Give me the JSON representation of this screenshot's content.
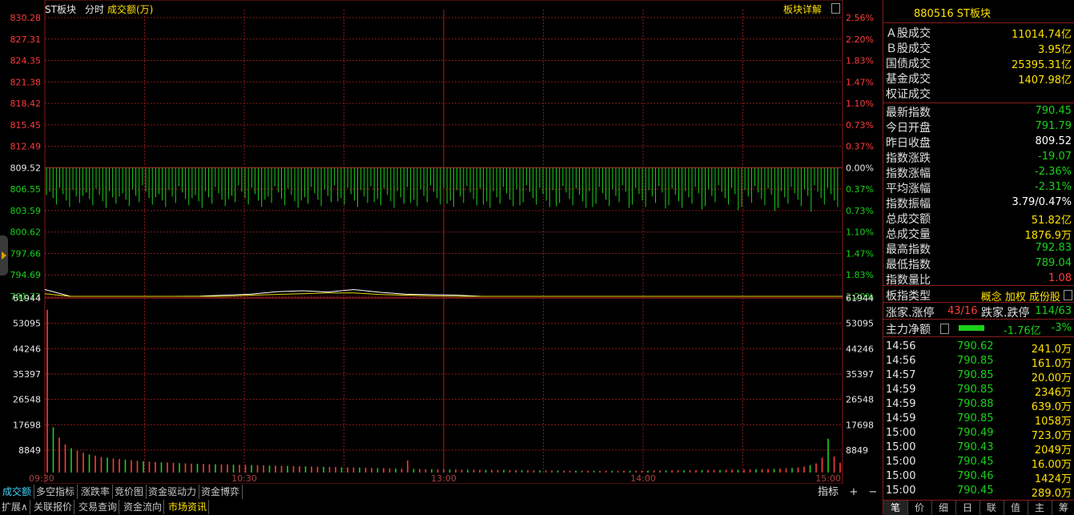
{
  "header": {
    "title": "ST板块",
    "period": "分时",
    "indicator": "成交额(万)",
    "detail_link": "板块详解"
  },
  "colors": {
    "up": "#ff3b3b",
    "down": "#1ad11a",
    "flat": "#e8e8e8",
    "accent": "#ffe100",
    "grid": "#8a1a1a",
    "price_line": "#ffffff",
    "avg_line": "#e6d600"
  },
  "chart_data": [
    {
      "type": "line",
      "title": "ST板块 分时",
      "y_left_ticks": [
        "830.28",
        "827.31",
        "824.35",
        "821.38",
        "818.42",
        "815.45",
        "812.49",
        "809.52",
        "806.55",
        "803.59",
        "800.62",
        "797.66",
        "794.69",
        "791.73"
      ],
      "y_right_ticks": [
        "2.56%",
        "2.20%",
        "1.83%",
        "1.47%",
        "1.10%",
        "0.73%",
        "0.37%",
        "0.00%",
        "0.37%",
        "0.73%",
        "1.10%",
        "1.47%",
        "1.83%",
        "2.20%"
      ],
      "ylim": [
        791.73,
        830.28
      ],
      "base": 809.52,
      "series": [
        {
          "values": [
            792.6,
            790.4,
            790.9,
            791.0,
            791.3,
            791.6,
            791.7,
            791.9,
            792.1,
            792.3,
            792.5,
            792.4,
            792.6,
            792.3,
            792.1,
            791.9,
            791.9,
            791.6,
            791.6,
            791.4,
            791.2,
            791.1,
            790.8,
            790.8,
            790.9,
            790.9,
            790.8,
            790.5,
            790.5,
            790.7,
            790.6,
            790.45
          ]
        },
        {
          "values": [
            792.1,
            790.6,
            790.1,
            790.8,
            791.4,
            791.5,
            791.6,
            791.7,
            791.9,
            792.0,
            792.1,
            792.2,
            792.2,
            792.0,
            791.9,
            791.8,
            791.7,
            791.6,
            791.5,
            791.3,
            791.2,
            791.0,
            790.8,
            790.8,
            790.9,
            790.8,
            790.8,
            790.6,
            790.6,
            790.6,
            790.6,
            790.7
          ]
        }
      ]
    },
    {
      "type": "bar",
      "title": "成交额(万)",
      "y_ticks": [
        "61944",
        "53095",
        "44246",
        "35397",
        "26548",
        "17698",
        "8849"
      ],
      "ylim": [
        0,
        61944
      ],
      "x_ticks": [
        "09:30",
        "10:30",
        "13:00",
        "14:00",
        "15:00"
      ],
      "values": [
        56800,
        15800,
        12200,
        9800,
        8500,
        7600,
        6900,
        6300,
        5900,
        5400,
        5200,
        4900,
        4700,
        4500,
        4300,
        4100,
        3900,
        3800,
        3700,
        3600,
        3500,
        3400,
        3300,
        3200,
        3100,
        3050,
        3000,
        2950,
        2900,
        2850,
        2800,
        2750,
        2700,
        2650,
        2600,
        2550,
        2500,
        2450,
        2400,
        2350,
        2300,
        2250,
        2200,
        2150,
        2100,
        2050,
        2000,
        1950,
        1900,
        1850,
        1800,
        1750,
        1700,
        1650,
        1600,
        1550,
        1500,
        1450,
        1400,
        1350,
        4200,
        1300,
        1250,
        1200,
        1150,
        1100,
        1100,
        1050,
        1050,
        1000,
        1000,
        980,
        960,
        940,
        920,
        900,
        880,
        860,
        840,
        820,
        800,
        780,
        760,
        740,
        720,
        700,
        690,
        680,
        670,
        660,
        650,
        640,
        630,
        620,
        610,
        600,
        620,
        640,
        660,
        680,
        700,
        720,
        740,
        760,
        780,
        800,
        820,
        840,
        860,
        880,
        900,
        920,
        940,
        960,
        980,
        1000,
        1050,
        1100,
        1150,
        1200,
        1250,
        1300,
        1400,
        1500,
        1600,
        1800,
        2100,
        2600,
        3200,
        5200,
        11800,
        5600,
        3400
      ]
    }
  ],
  "bottom_tabs": [
    "成交额",
    "多空指标",
    "涨跌率",
    "竞价图",
    "资金驱动力",
    "资金博弈"
  ],
  "bottom_right": {
    "index_label": "指标",
    "plus": "+",
    "minus": "−"
  },
  "bottom_bar": [
    "扩展∧",
    "关联报价",
    "交易查询",
    "资金流向",
    "市场资讯"
  ],
  "side": {
    "code_title": "880516  ST板块",
    "turnover": [
      {
        "label": "Ａ股成交",
        "value": "11014.74亿",
        "color": "#ffe100"
      },
      {
        "label": "Ｂ股成交",
        "value": "3.95亿",
        "color": "#ffe100"
      },
      {
        "label": "国债成交",
        "value": "25395.31亿",
        "color": "#ffe100"
      },
      {
        "label": "基金成交",
        "value": "1407.98亿",
        "color": "#ffe100"
      },
      {
        "label": "权证成交",
        "value": "",
        "color": "#ffe100"
      }
    ],
    "stats": [
      {
        "label": "最新指数",
        "value": "790.45",
        "color": "#1ad11a"
      },
      {
        "label": "今日开盘",
        "value": "791.79",
        "color": "#1ad11a"
      },
      {
        "label": "昨日收盘",
        "value": "809.52",
        "color": "#ffffff"
      },
      {
        "label": "指数涨跌",
        "value": "-19.07",
        "color": "#1ad11a"
      },
      {
        "label": "指数涨幅",
        "value": "-2.36%",
        "color": "#1ad11a"
      },
      {
        "label": "平均涨幅",
        "value": "-2.31%",
        "color": "#1ad11a"
      },
      {
        "label": "指数振幅",
        "value": "3.79/0.47%",
        "color": "#ffffff"
      },
      {
        "label": "总成交额",
        "value": "51.82亿",
        "color": "#ffe100"
      },
      {
        "label": "总成交量",
        "value": "1876.9万",
        "color": "#ffe100"
      },
      {
        "label": "最高指数",
        "value": "792.83",
        "color": "#1ad11a"
      },
      {
        "label": "最低指数",
        "value": "789.04",
        "color": "#1ad11a"
      },
      {
        "label": "指数量比",
        "value": "1.08",
        "color": "#ff3b3b"
      }
    ],
    "type_label": "板指类型",
    "type_values": "概念 加权 成份股",
    "rise_label": "涨家.涨停",
    "rise_value": "43/16",
    "fall_label": "跌家.跌停",
    "fall_value": "114/63",
    "main_flow_label": "主力净额",
    "main_flow_value": "-1.76亿",
    "main_flow_pct": "-3%",
    "ticks": [
      {
        "time": "14:56",
        "price": "790.62",
        "amount": "241.0万"
      },
      {
        "time": "14:56",
        "price": "790.85",
        "amount": "161.0万"
      },
      {
        "time": "14:57",
        "price": "790.85",
        "amount": "20.00万"
      },
      {
        "time": "14:59",
        "price": "790.85",
        "amount": "2346万"
      },
      {
        "time": "14:59",
        "price": "790.88",
        "amount": "639.0万"
      },
      {
        "time": "14:59",
        "price": "790.85",
        "amount": "1058万"
      },
      {
        "time": "15:00",
        "price": "790.49",
        "amount": "723.0万"
      },
      {
        "time": "15:00",
        "price": "790.43",
        "amount": "2049万"
      },
      {
        "time": "15:00",
        "price": "790.45",
        "amount": "16.00万"
      },
      {
        "time": "15:00",
        "price": "790.46",
        "amount": "1424万"
      },
      {
        "time": "15:00",
        "price": "790.45",
        "amount": "289.0万"
      }
    ],
    "tabs": [
      "笔",
      "价",
      "细",
      "日",
      "联",
      "值",
      "主",
      "筹"
    ]
  }
}
